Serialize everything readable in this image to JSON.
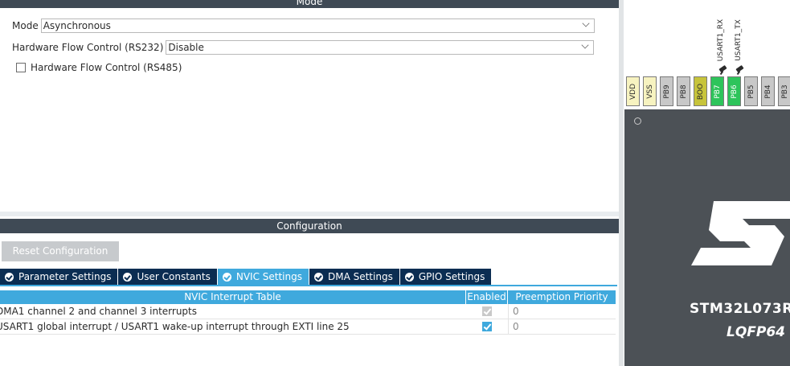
{
  "mode_section": {
    "title": "Mode",
    "mode_label": "Mode",
    "mode_value": "Asynchronous",
    "hfc232_label": "Hardware Flow Control (RS232)",
    "hfc232_value": "Disable",
    "hfc485_label": "Hardware Flow Control (RS485)",
    "hfc485_checked": false
  },
  "config_section": {
    "title": "Configuration",
    "reset_button": "Reset Configuration",
    "tabs": [
      {
        "label": "Parameter Settings",
        "active": false
      },
      {
        "label": "User Constants",
        "active": false
      },
      {
        "label": "NVIC Settings",
        "active": true
      },
      {
        "label": "DMA Settings",
        "active": false
      },
      {
        "label": "GPIO Settings",
        "active": false
      }
    ],
    "table": {
      "headers": [
        "NVIC Interrupt Table",
        "Enabled",
        "Preemption Priority"
      ],
      "rows": [
        {
          "name": "DMA1 channel 2 and channel 3 interrupts",
          "enabled": true,
          "locked": true,
          "priority": "0"
        },
        {
          "name": "USART1 global interrupt / USART1 wake-up interrupt through EXTI line 25",
          "enabled": true,
          "locked": false,
          "priority": "0"
        }
      ]
    }
  },
  "chip_view": {
    "pins": [
      {
        "label": "VDD",
        "kind": "power"
      },
      {
        "label": "VSS",
        "kind": "power"
      },
      {
        "label": "PB9",
        "kind": "gpio"
      },
      {
        "label": "PB8",
        "kind": "gpio"
      },
      {
        "label": "BOO",
        "kind": "boot"
      },
      {
        "label": "PB7",
        "kind": "assigned"
      },
      {
        "label": "PB6",
        "kind": "assigned"
      },
      {
        "label": "PB5",
        "kind": "gpio"
      },
      {
        "label": "PB4",
        "kind": "gpio"
      },
      {
        "label": "PB3",
        "kind": "gpio"
      }
    ],
    "signals": {
      "pb7": "USART1_RX",
      "pb6": "USART1_TX"
    },
    "part_name": "STM32L073R",
    "package": "LQFP64",
    "colors": {
      "assigned_pin": "#2ec45b",
      "boot_pin": "#c7c43b",
      "power_pin": "#f7f3c0",
      "chip_body": "#4c5156",
      "accent_tab": "#3fa9dd",
      "tab_bg": "#0b2d52"
    }
  }
}
